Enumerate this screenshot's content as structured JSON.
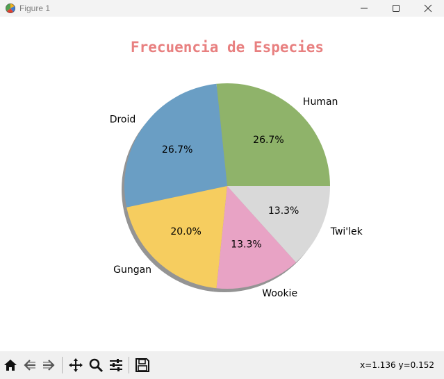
{
  "window": {
    "title": "Figure 1",
    "app_icon": "matplotlib-icon",
    "controls": [
      "minimize-icon",
      "maximize-icon",
      "close-icon"
    ]
  },
  "chart_data": {
    "type": "pie",
    "title": "Frecuencia de Especies",
    "title_color": "#e88080",
    "labels": [
      "Human",
      "Droid",
      "Gungan",
      "Wookie",
      "Twi'lek"
    ],
    "values": [
      4,
      4,
      3,
      2,
      2
    ],
    "percent_labels": [
      "26.7%",
      "26.7%",
      "20.0%",
      "13.3%",
      "13.3%"
    ],
    "colors": [
      "#8fb36a",
      "#6a9ec4",
      "#f6cd5f",
      "#e8a3c5",
      "#d9d9d9"
    ],
    "start_angle_deg": 0,
    "shadow": true
  },
  "toolbar": {
    "tools": [
      "home-icon",
      "back-icon",
      "forward-icon",
      "pan-icon",
      "zoom-icon",
      "configure-subplots-icon",
      "save-icon"
    ],
    "coords": "x=1.136 y=0.152"
  }
}
